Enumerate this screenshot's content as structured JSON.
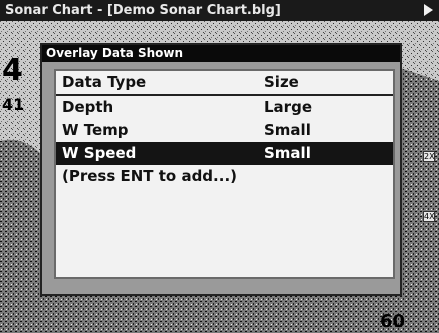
{
  "window": {
    "title": "Sonar Chart - [Demo Sonar Chart.blg]",
    "nav_icon": "right-arrow-icon"
  },
  "chart": {
    "depth_labels": [
      "4",
      "41",
      "60"
    ],
    "scale_tags": [
      "2X",
      "4X"
    ]
  },
  "dialog": {
    "title": "Overlay Data Shown",
    "columns": {
      "type": "Data Type",
      "size": "Size"
    },
    "rows": [
      {
        "type": "Depth",
        "size": "Large",
        "selected": false
      },
      {
        "type": "W Temp",
        "size": "Small",
        "selected": false
      },
      {
        "type": "W Speed",
        "size": "Small",
        "selected": true
      }
    ],
    "hint": "(Press ENT to add...)"
  }
}
